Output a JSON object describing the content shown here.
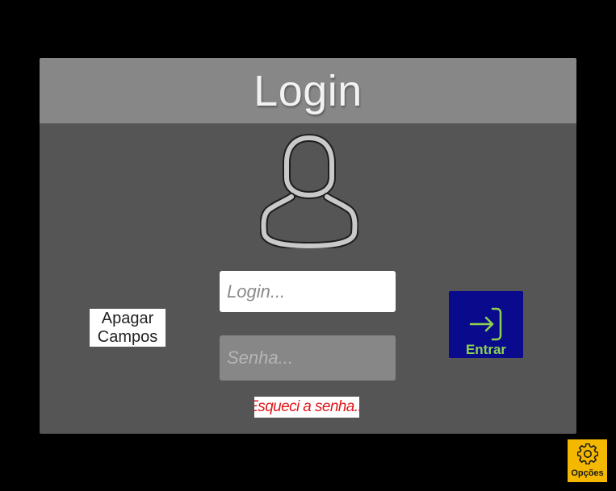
{
  "panel": {
    "title": "Login"
  },
  "form": {
    "login_placeholder": "Login...",
    "login_value": "",
    "password_placeholder": "Senha...",
    "password_value": "",
    "clear_button": {
      "line1": "Apagar",
      "line2": "Campos"
    },
    "forgot_link": "Esqueci a senha...",
    "enter_button": {
      "label": "Entrar",
      "icon": "login-arrow-icon"
    }
  },
  "avatar": {
    "icon": "user-avatar-icon"
  },
  "options": {
    "label": "Opções",
    "icon": "gear-icon"
  },
  "colors": {
    "background": "#000000",
    "panel": "#555555",
    "header": "#878787",
    "title_text": "#f2f2f2",
    "enter_button": "#0a0a8c",
    "enter_accent": "#8fd14f",
    "forgot_text": "#e0181b",
    "options_button": "#f5b800"
  }
}
